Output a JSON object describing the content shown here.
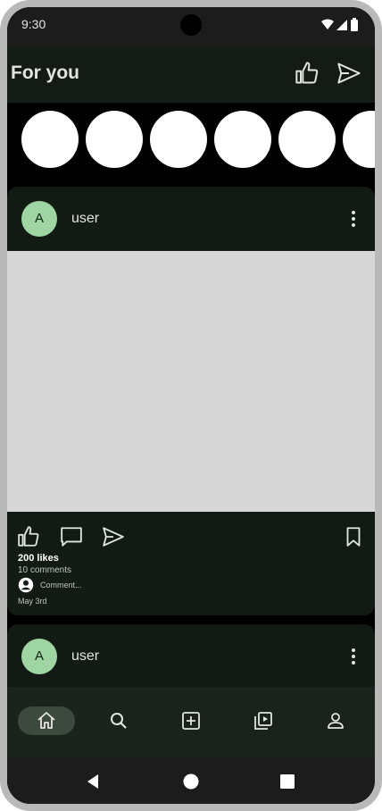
{
  "status_bar": {
    "time": "9:30"
  },
  "app_bar": {
    "title": "For you",
    "actions": [
      "like-icon",
      "send-icon"
    ]
  },
  "stories": {
    "count": 6
  },
  "posts": [
    {
      "avatar_letter": "A",
      "username": "user",
      "likes": "200 likes",
      "comments": "10 comments",
      "comment_placeholder": "Comment...",
      "date": "May 3rd"
    },
    {
      "avatar_letter": "A",
      "username": "user"
    }
  ],
  "bottom_nav": {
    "items": [
      "home-icon",
      "search-icon",
      "add-box-icon",
      "video-library-icon",
      "person-icon"
    ],
    "active": "home-icon"
  },
  "system_nav": [
    "back-icon",
    "home-circle-icon",
    "recents-icon"
  ],
  "colors": {
    "app_bar_bg": "#141b15",
    "card_bg": "#121a14",
    "nav_bg": "#1a231b",
    "active_indicator": "#3c4a3d",
    "avatar_bg": "#9fd4a3",
    "image_placeholder": "#d7d7d7"
  }
}
